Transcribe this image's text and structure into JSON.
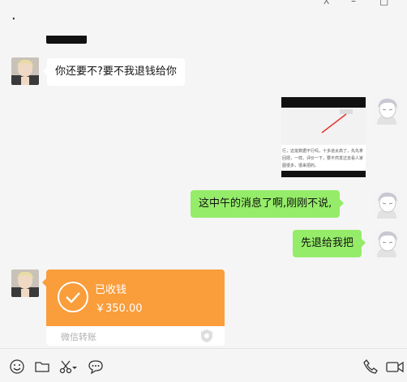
{
  "header": {
    "title": "."
  },
  "messages": {
    "incoming_1": "你还要不?要不我退钱给你",
    "outgoing_1": "这中午的消息了啊,刚刚不说,",
    "outgoing_2": "先退给我把"
  },
  "image_message": {
    "lines": [
      "行，这批数据不行吗，十多道太高了，先先拿",
      "回把，一样。评价一下，要不然发过去看人家",
      "图很多，很来把的。"
    ]
  },
  "transfer": {
    "status": "已收钱",
    "amount": "￥350.00",
    "footer": "微信转账",
    "accent_color": "#fa9d3b"
  },
  "toolbar": {
    "left_icons": [
      "emoji-icon",
      "folder-icon",
      "scissors-icon",
      "chat-bubble-icon"
    ],
    "right_icons": [
      "phone-icon",
      "video-call-icon"
    ]
  }
}
